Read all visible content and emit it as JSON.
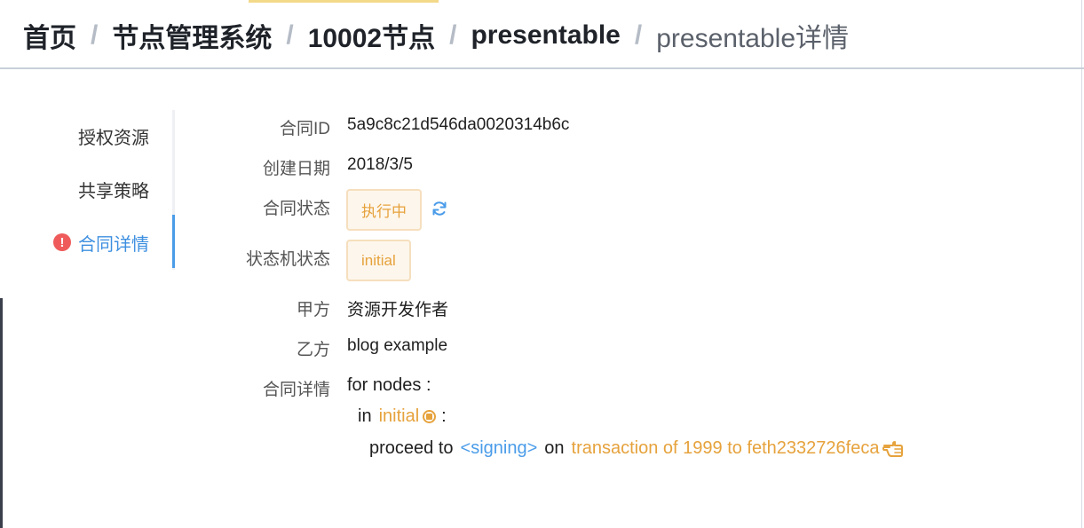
{
  "breadcrumb": [
    {
      "label": "首页"
    },
    {
      "label": "节点管理系统"
    },
    {
      "label": "10002节点"
    },
    {
      "label": "presentable"
    },
    {
      "label": "presentable详情"
    }
  ],
  "breadcrumb_separator": "/",
  "side_tabs": [
    {
      "label": "授权资源",
      "active": false
    },
    {
      "label": "共享策略",
      "active": false
    },
    {
      "label": "合同详情",
      "active": true,
      "icon": "exclamation-circle-icon",
      "icon_glyph": "!"
    }
  ],
  "contract": {
    "id_label": "合同ID",
    "id_value": "5a9c8c21d546da0020314b6c",
    "date_label": "创建日期",
    "date_value": "2018/3/5",
    "status_label": "合同状态",
    "status_value": "执行中",
    "machine_label": "状态机状态",
    "machine_value": "initial",
    "party_a_label": "甲方",
    "party_a_value": "资源开发作者",
    "party_b_label": "乙方",
    "party_b_value": "blog example",
    "detail_label": "合同详情",
    "detail_line1": "for nodes :",
    "detail_in": "in",
    "detail_state": "initial",
    "detail_colon": ":",
    "detail_proceed": "proceed to",
    "detail_target": "<signing>",
    "detail_on": "on",
    "detail_event": "transaction of 1999 to feth2332726feca"
  },
  "colors": {
    "accent_blue": "#4a9ce9",
    "warning_orange": "#e6a23c",
    "error_red": "#ef5b5b"
  }
}
